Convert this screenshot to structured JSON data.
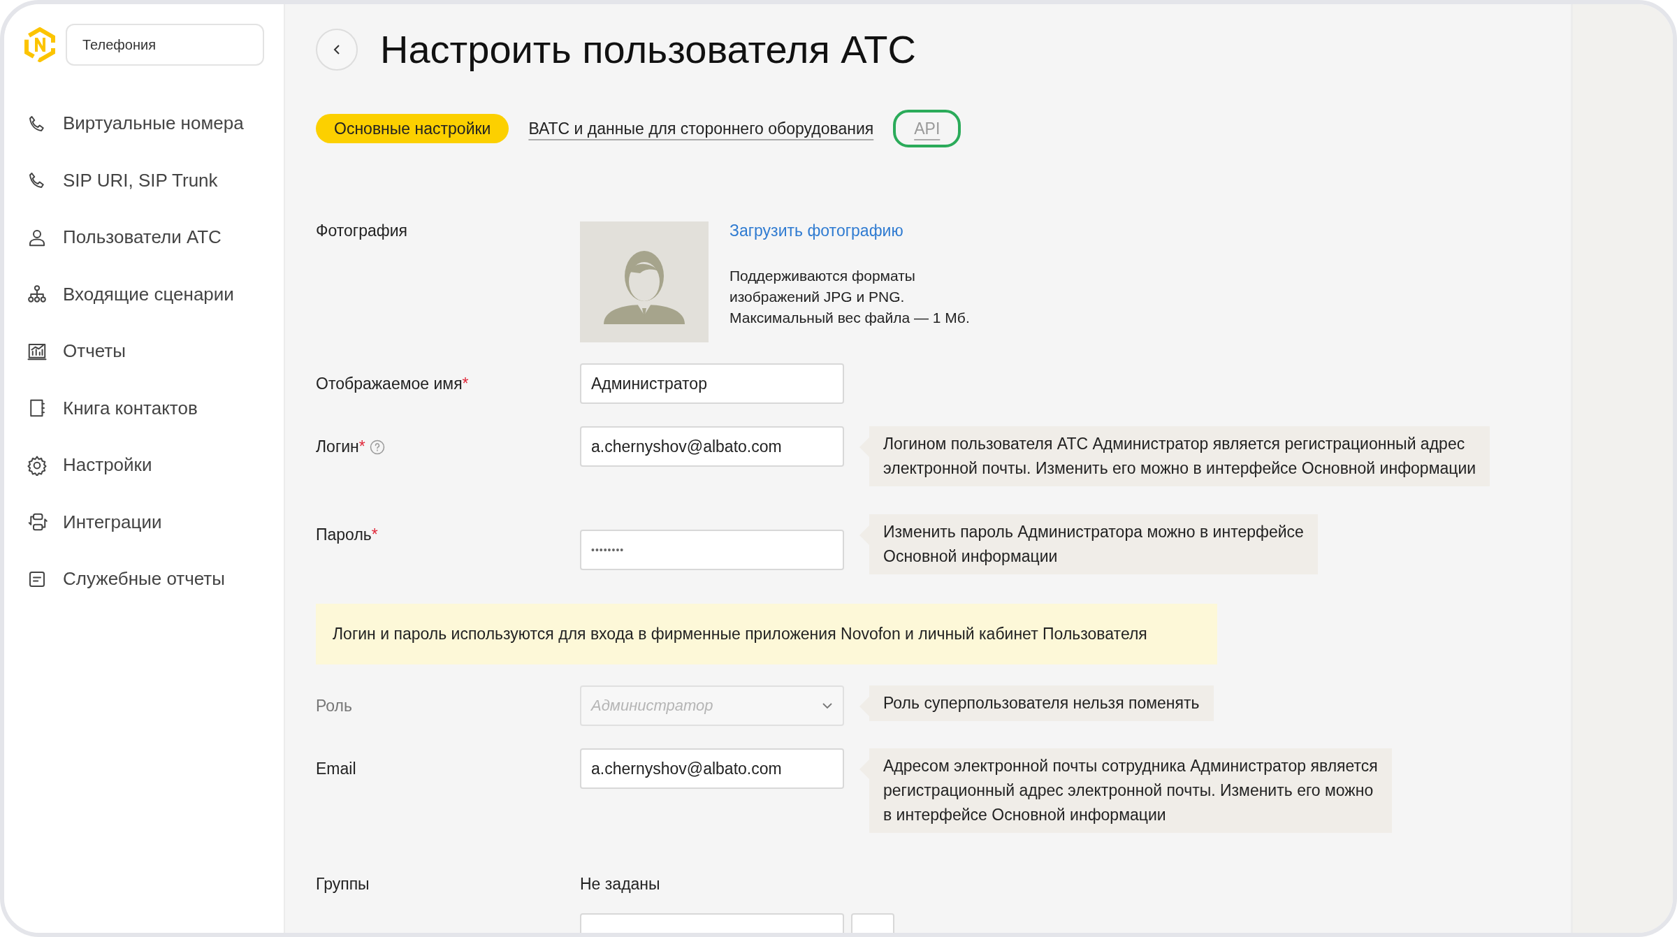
{
  "sidebar": {
    "search": {
      "value": "Телефония"
    },
    "items": [
      {
        "label": "Виртуальные номера"
      },
      {
        "label": "SIP URI, SIP Trunk"
      },
      {
        "label": "Пользователи АТС"
      },
      {
        "label": "Входящие сценарии"
      },
      {
        "label": "Отчеты"
      },
      {
        "label": "Книга контактов"
      },
      {
        "label": "Настройки"
      },
      {
        "label": "Интеграции"
      },
      {
        "label": "Служебные отчеты"
      }
    ]
  },
  "page": {
    "title": "Настроить пользователя АТС"
  },
  "tabs": [
    {
      "label": "Основные настройки",
      "selected": true,
      "focused": false
    },
    {
      "label": "ВАТС и данные для стороннего оборудования",
      "selected": false,
      "focused": false
    },
    {
      "label": "API",
      "selected": false,
      "focused": true
    }
  ],
  "form": [
    {
      "kind": "photo",
      "label": "Фотография",
      "link": "Загрузить фотографию",
      "hint": "Поддерживаются форматы\nизображений JPG и PNG.\nМаксимальный вес файла — 1 Мб."
    },
    {
      "kind": "text",
      "label": "Отображаемое имя",
      "required_mark": "*",
      "value": "Администратор"
    },
    {
      "kind": "text",
      "label": "Логин",
      "required_mark": "*",
      "help": true,
      "value": "a.chernyshov@albato.com",
      "tooltip": "Логином пользователя АТС Администратор является регистрационный адрес\nэлектронной почты. Изменить его можно в интерфейсе Основной информации"
    },
    {
      "kind": "password",
      "label": "Пароль",
      "required_mark": "*",
      "value": "••••••••",
      "tooltip": "Изменить пароль Администратора можно в интерфейсе\nОсновной информации"
    },
    {
      "kind": "notice",
      "text": "Логин и пароль используются для входа в фирменные приложения Novofon и личный кабинет Пользователя"
    },
    {
      "kind": "select",
      "label": "Роль",
      "disabled": true,
      "value": "Администратор",
      "tooltip": "Роль суперпользователя нельзя поменять"
    },
    {
      "kind": "text",
      "label": "Email",
      "value": "a.chernyshov@albato.com",
      "tooltip": "Адресом электронной почты сотрудника Администратор является\nрегистрационный адрес электронной почты. Изменить его можно\nв интерфейсе Основной информации"
    },
    {
      "kind": "static",
      "label": "Группы",
      "value": "Не заданы"
    },
    {
      "kind": "partial"
    }
  ]
}
